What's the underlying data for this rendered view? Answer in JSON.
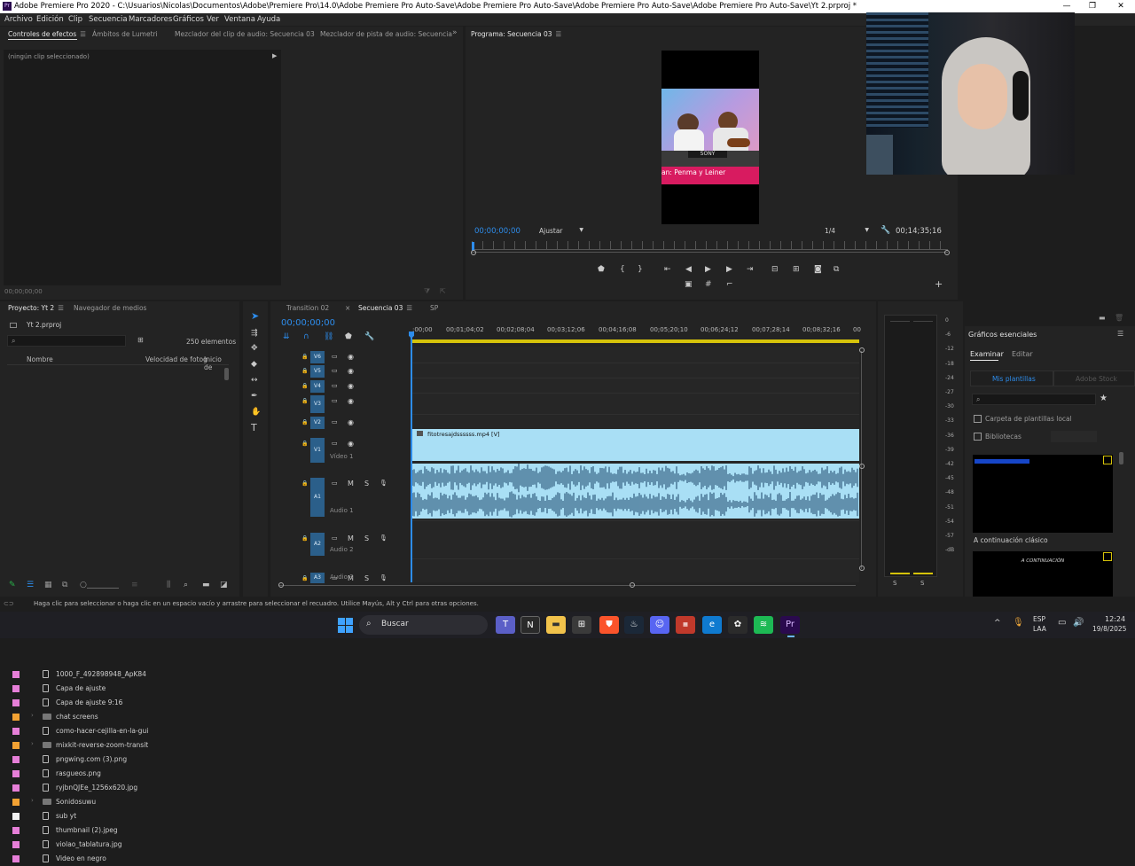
{
  "window": {
    "title": "Adobe Premiere Pro 2020 - C:\\Usuarios\\Nicolas\\Documentos\\Adobe\\Premiere Pro\\14.0\\Adobe Premiere Pro Auto-Save\\Adobe Premiere Pro Auto-Save\\Adobe Premiere Pro Auto-Save\\Adobe Premiere Pro Auto-Save\\Yt 2.prproj *",
    "logo_text": "Pr",
    "minimize": "—",
    "maximize": "❐",
    "close": "✕"
  },
  "menu": [
    "Archivo",
    "Edición",
    "Clip",
    "Secuencia",
    "Marcadores",
    "Gráficos",
    "Ver",
    "Ventana",
    "Ayuda"
  ],
  "source_panel": {
    "tabs": [
      "Controles de efectos",
      "Ámbitos de Lumetri",
      "Mezclador del clip de audio: Secuencia 03",
      "Mezclador de pista de audio: Secuencia"
    ],
    "more": "»",
    "no_clip": "(ningún clip seleccionado)",
    "timecode": "00;00;00;00"
  },
  "program": {
    "tab": "Programa: Secuencia 03",
    "overlay_text": "an: Penma y Leiner",
    "timecode": "00;00;00;00",
    "fit": "Ajustar",
    "resolution": "1/4",
    "duration": "00;14;35;16"
  },
  "project": {
    "tab": "Proyecto: Yt 2",
    "media_tab": "Navegador de medios",
    "file": "Yt 2.prproj",
    "count": "250 elementos",
    "columns": [
      "Nombre",
      "Velocidad de fotog",
      "Inicio de"
    ],
    "items": [
      {
        "name": "1000_F_492898948_ApK84",
        "color": "#e67fd8",
        "type": "file"
      },
      {
        "name": "Capa de ajuste",
        "color": "#e67fd8",
        "type": "file"
      },
      {
        "name": "Capa de ajuste 9:16",
        "color": "#e67fd8",
        "type": "file"
      },
      {
        "name": "chat screens",
        "color": "#f3a233",
        "type": "folder"
      },
      {
        "name": "como-hacer-cejilla-en-la-gui",
        "color": "#e67fd8",
        "type": "file"
      },
      {
        "name": "mixkit-reverse-zoom-transit",
        "color": "#f3a233",
        "type": "folder"
      },
      {
        "name": "pngwing.com (3).png",
        "color": "#e67fd8",
        "type": "file"
      },
      {
        "name": "rasgueos.png",
        "color": "#e67fd8",
        "type": "file"
      },
      {
        "name": "ryjbnQJEe_1256x620.jpg",
        "color": "#e67fd8",
        "type": "file"
      },
      {
        "name": "Sonidosuwu",
        "color": "#f3a233",
        "type": "folder"
      },
      {
        "name": "sub yt",
        "color": "#f2f2f2",
        "type": "file"
      },
      {
        "name": "thumbnail (2).jpeg",
        "color": "#e67fd8",
        "type": "file"
      },
      {
        "name": "violao_tablatura.jpg",
        "color": "#e67fd8",
        "type": "file"
      },
      {
        "name": "Video en negro",
        "color": "#e67fd8",
        "type": "file"
      }
    ]
  },
  "timeline": {
    "tabs": [
      "Transition 02",
      "Secuencia 03",
      "SP"
    ],
    "close_icon": "×",
    "timecode": "00;00;00;00",
    "ruler": [
      ";00;00",
      "00;01;04;02",
      "00;02;08;04",
      "00;03;12;06",
      "00;04;16;08",
      "00;05;20;10",
      "00;06;24;12",
      "00;07;28;14",
      "00;08;32;16",
      "00"
    ],
    "tracks": [
      {
        "label": "V6"
      },
      {
        "label": "V5"
      },
      {
        "label": "V4"
      },
      {
        "label": "V3"
      },
      {
        "label": "V2"
      },
      {
        "label": "V1",
        "name": "Vídeo 1"
      },
      {
        "label": "A1",
        "name": "Audio 1"
      },
      {
        "label": "A2",
        "name": "Audio 2"
      },
      {
        "label": "A3",
        "name": "Audio 3"
      }
    ],
    "clip_name": "fitotresajdssssss.mp4 [V]",
    "audio_lane_labels": [
      "M",
      "S"
    ],
    "vu_scale": [
      "0",
      "-6",
      "-12",
      "-18",
      "-24",
      "-27",
      "-30",
      "-33",
      "-36",
      "-39",
      "-42",
      "-45",
      "-48",
      "-51",
      "-54",
      "-57",
      "-dB"
    ],
    "vu_sides": [
      "S",
      "S"
    ]
  },
  "essential": {
    "title": "Gráficos esenciales",
    "tabs": [
      "Examinar",
      "Editar"
    ],
    "templates": "Mis plantillas",
    "stock": "Adobe Stock",
    "local": "Carpeta de plantillas local",
    "libs": "Bibliotecas",
    "thumb1_label": "A continuación clásico",
    "thumb2_text": "A CONTINUACIÓN"
  },
  "status": "Haga clic para seleccionar o haga clic en un espacio vacío y arrastre para seleccionar el recuadro. Utilice Mayús, Alt y Ctrl para otras opciones.",
  "taskbar": {
    "search": "Buscar",
    "lang1": "ESP",
    "lang2": "LAA",
    "time": "12:24",
    "date": "19/8/2025"
  },
  "colors": {
    "accent": "#2d8ceb",
    "video_clip": "#a9dff5",
    "audio_clip": "#a9dff5",
    "track_label": "#2b5f8a"
  }
}
